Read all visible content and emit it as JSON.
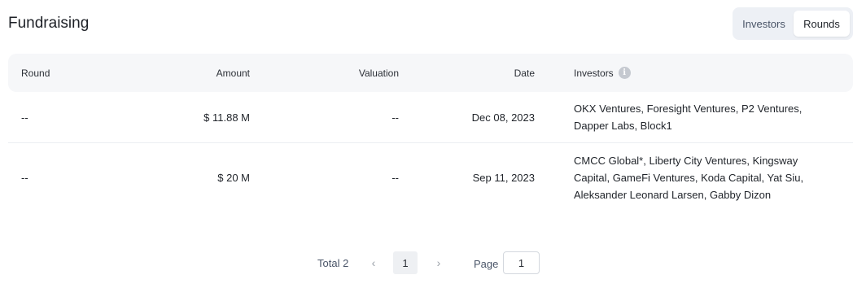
{
  "header": {
    "title": "Fundraising"
  },
  "toggle": {
    "investors_label": "Investors",
    "rounds_label": "Rounds",
    "active": "rounds"
  },
  "table": {
    "columns": {
      "round": "Round",
      "amount": "Amount",
      "valuation": "Valuation",
      "date": "Date",
      "investors": "Investors"
    },
    "info_icon": "info-icon",
    "rows": [
      {
        "round": "--",
        "amount": "$ 11.88 M",
        "valuation": "--",
        "date": "Dec 08, 2023",
        "investors": "OKX Ventures, Foresight Ventures, P2 Ventures, Dapper Labs, Block1"
      },
      {
        "round": "--",
        "amount": "$ 20 M",
        "valuation": "--",
        "date": "Sep 11, 2023",
        "investors": "CMCC Global*, Liberty City Ventures, Kingsway Capital, GameFi Ventures, Koda Capital, Yat Siu, Aleksander Leonard Larsen, Gabby Dizon"
      }
    ]
  },
  "pagination": {
    "total_label": "Total 2",
    "prev_icon": "‹",
    "next_icon": "›",
    "current_page": "1",
    "page_label": "Page",
    "page_input_value": "1"
  }
}
